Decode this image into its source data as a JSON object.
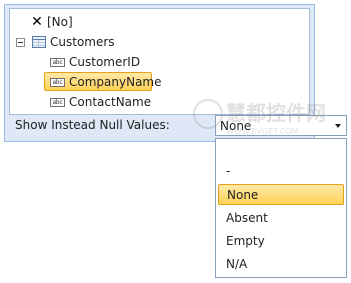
{
  "tree": {
    "items": [
      {
        "label": "[No]",
        "icon": "x-icon"
      },
      {
        "label": "Customers",
        "icon": "table-icon",
        "expander": "collapse"
      },
      {
        "label": "CustomerID",
        "icon": "field-icon"
      },
      {
        "label": "CompanyName",
        "icon": "field-icon",
        "selected": true
      },
      {
        "label": "ContactName",
        "icon": "field-icon"
      }
    ],
    "field_icon_text": "abc"
  },
  "null_values": {
    "label": "Show Instead Null Values:",
    "selected_value": "None",
    "options": [
      "-",
      "None",
      "Absent",
      "Empty",
      "N/A"
    ]
  },
  "watermark": {
    "text_cn": "慧都控件网",
    "text_url": "WWW.EVGET.COM"
  },
  "colors": {
    "panel_bg": "#dfe8f6",
    "panel_border": "#99bbe8",
    "highlight_top": "#ffe9a8",
    "highlight_bottom": "#ffd257",
    "highlight_border": "#e3a21a"
  }
}
